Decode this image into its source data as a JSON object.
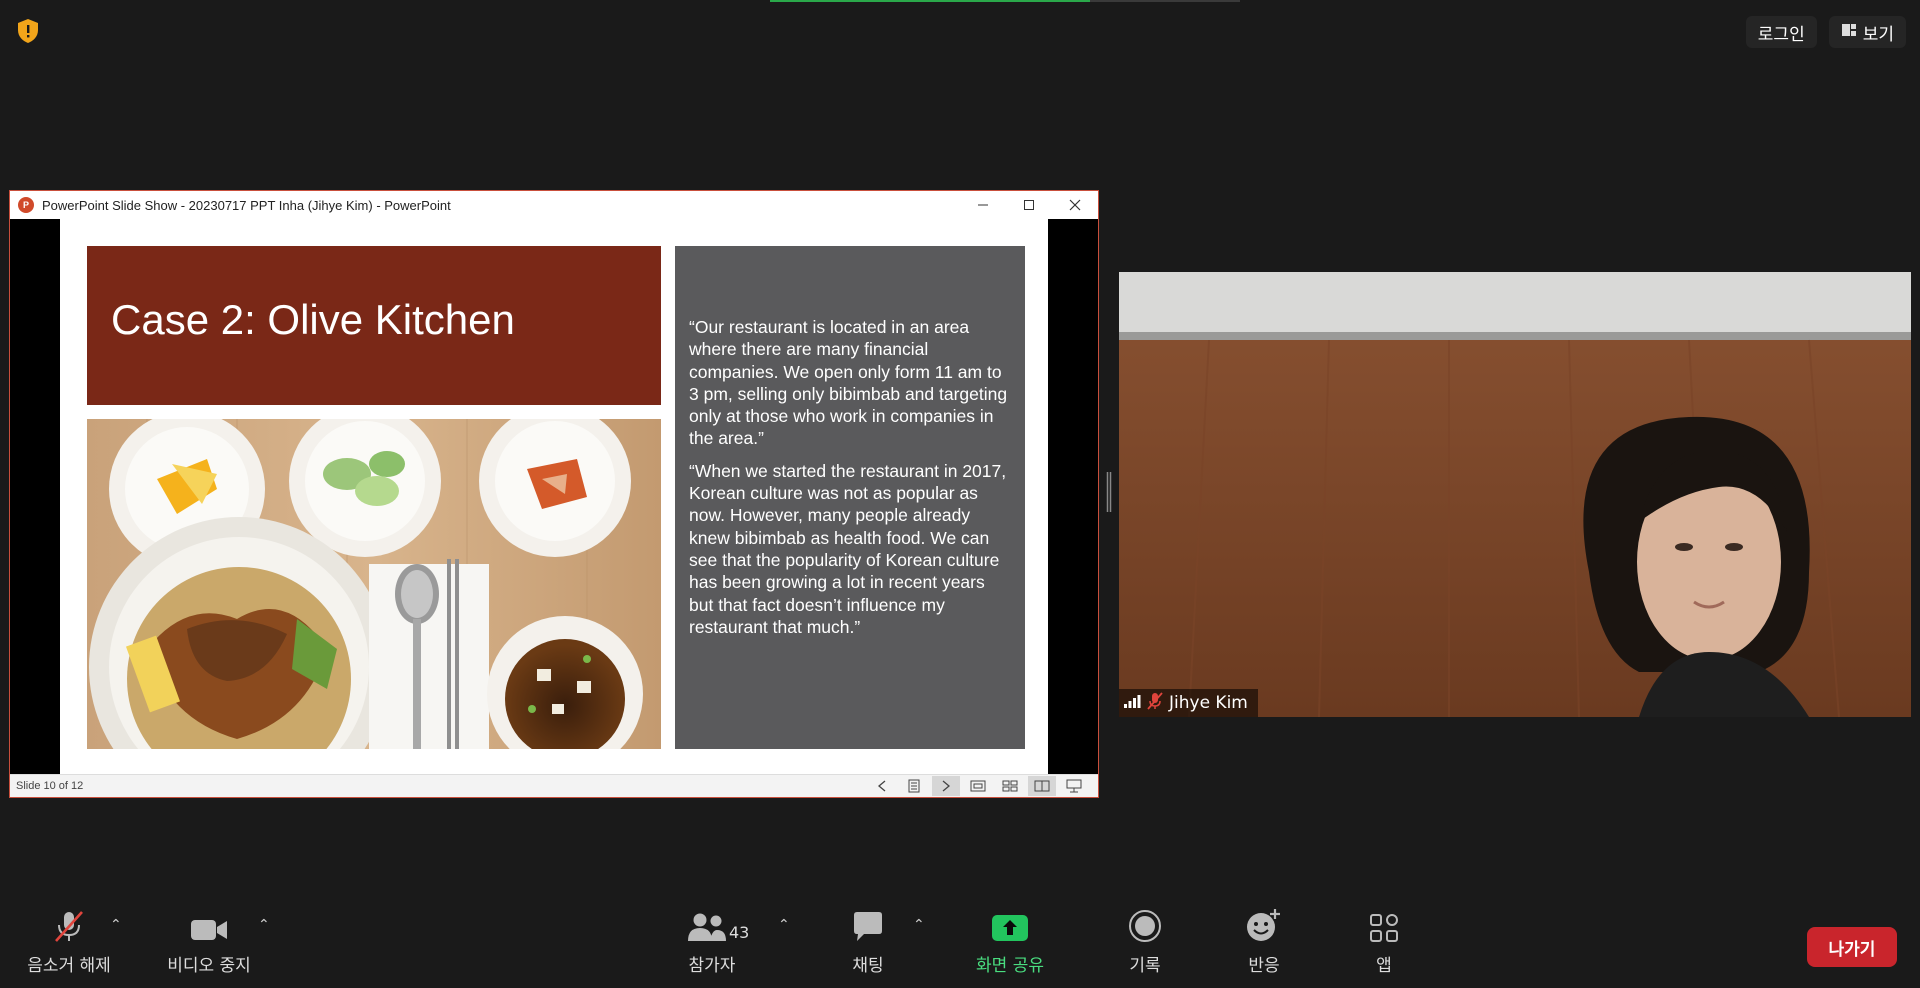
{
  "top": {
    "login_label": "로그인",
    "view_label": "보기"
  },
  "ppt": {
    "window_title": "PowerPoint Slide Show  -  20230717 PPT Inha (Jihye Kim) - PowerPoint",
    "slide_title": "Case 2: Olive Kitchen",
    "quote_1": "“Our restaurant is located in an area where there are many financial companies. We open only form 11 am to 3 pm, selling only bibimbab and targeting only at those who work in companies in the area.”",
    "quote_2": "“When we started the restaurant in 2017, Korean culture was not as popular as now. However, many people already knew bibimbab as health food. We can see that the popularity of Korean culture has been growing a lot in recent years but that fact doesn’t influence my restaurant that much.”",
    "status_text": "Slide 10 of 12"
  },
  "participant": {
    "name": "Jihye Kim"
  },
  "toolbar": {
    "mute_label": "음소거 해제",
    "video_label": "비디오 중지",
    "participants_label": "참가자",
    "participants_count": "43",
    "chat_label": "채팅",
    "share_label": "화면 공유",
    "record_label": "기록",
    "reactions_label": "반응",
    "apps_label": "앱",
    "leave_label": "나가기"
  },
  "colors": {
    "background": "#1a1a1a",
    "slide_title_bg": "#7a2817",
    "quote_bg": "#5a5a5c",
    "share_green": "#22c55e",
    "leave_red": "#c9252c"
  }
}
